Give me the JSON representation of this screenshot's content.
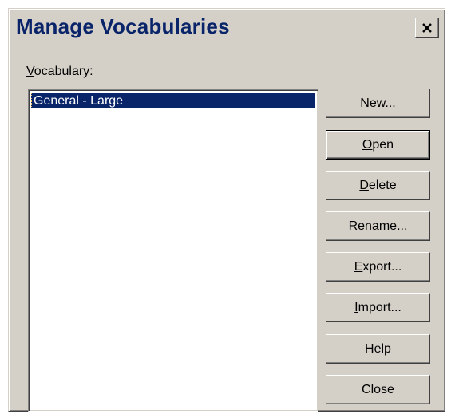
{
  "dialog": {
    "title": "Manage Vocabularies",
    "close_icon": "close-icon"
  },
  "vocabulary": {
    "label_mnemonic": "V",
    "label_rest": "ocabulary:",
    "items": [
      {
        "label": "General - Large",
        "selected": true
      }
    ]
  },
  "buttons": {
    "new": {
      "mnemonic": "N",
      "rest": "ew..."
    },
    "open": {
      "mnemonic": "O",
      "rest": "pen"
    },
    "delete": {
      "mnemonic": "D",
      "rest": "elete"
    },
    "rename": {
      "mnemonic": "R",
      "rest": "ename..."
    },
    "export": {
      "pre": "",
      "mnemonic": "E",
      "rest": "xport..."
    },
    "import": {
      "mnemonic": "I",
      "rest": "mport..."
    },
    "help": {
      "label": "Help"
    },
    "close": {
      "label": "Close"
    }
  },
  "colors": {
    "dialog_bg": "#d4d0c8",
    "title_text": "#0a246a",
    "selection_bg": "#0a246a",
    "selection_text": "#ffffff"
  }
}
